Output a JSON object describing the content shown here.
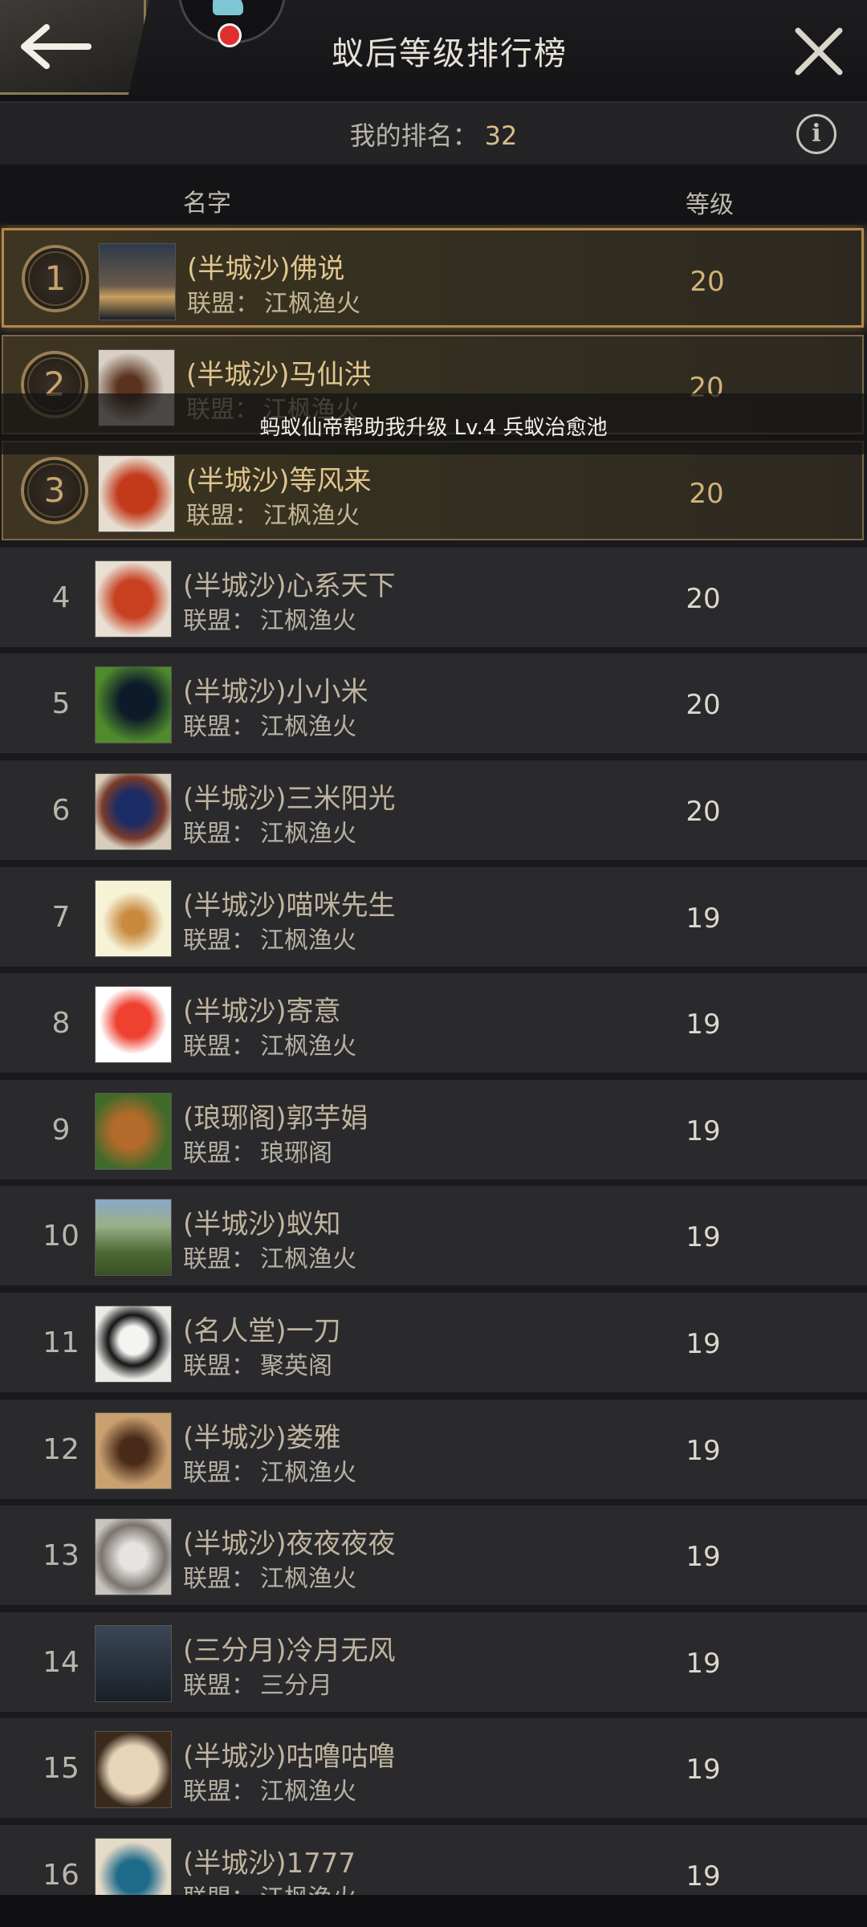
{
  "header": {
    "title": "蚁后等级排行榜"
  },
  "my_rank": {
    "label": "我的排名：",
    "value": "32"
  },
  "columns": {
    "name": "名字",
    "level": "等级"
  },
  "alliance_label": "联盟：",
  "toast": "蚂蚁仙帝帮助我升级 Lv.4 兵蚁治愈池",
  "colors": {
    "accent_gold": "#d3b27a",
    "background": "#1a1a1c",
    "row_background": "#2a292b",
    "toast_text": "#f3f1ec"
  },
  "icons": {
    "back": "arrow-left-icon",
    "close": "close-icon",
    "info": "info-icon",
    "medal": "rank-medal-icon"
  },
  "rows": [
    {
      "rank": "1",
      "name": "(半城沙)佛说",
      "alliance": "江枫渔火",
      "level": "20"
    },
    {
      "rank": "2",
      "name": "(半城沙)马仙洪",
      "alliance": "江枫渔火",
      "level": "20"
    },
    {
      "rank": "3",
      "name": "(半城沙)等风来",
      "alliance": "江枫渔火",
      "level": "20"
    },
    {
      "rank": "4",
      "name": "(半城沙)心系天下",
      "alliance": "江枫渔火",
      "level": "20"
    },
    {
      "rank": "5",
      "name": "(半城沙)小小米",
      "alliance": "江枫渔火",
      "level": "20"
    },
    {
      "rank": "6",
      "name": "(半城沙)三米阳光",
      "alliance": "江枫渔火",
      "level": "20"
    },
    {
      "rank": "7",
      "name": "(半城沙)喵咪先生",
      "alliance": "江枫渔火",
      "level": "19"
    },
    {
      "rank": "8",
      "name": "(半城沙)寄意",
      "alliance": "江枫渔火",
      "level": "19"
    },
    {
      "rank": "9",
      "name": "(琅琊阁)郭芋娟",
      "alliance": "琅琊阁",
      "level": "19"
    },
    {
      "rank": "10",
      "name": "(半城沙)蚁知",
      "alliance": "江枫渔火",
      "level": "19"
    },
    {
      "rank": "11",
      "name": "(名人堂)一刀",
      "alliance": "聚英阁",
      "level": "19"
    },
    {
      "rank": "12",
      "name": "(半城沙)娄雅",
      "alliance": "江枫渔火",
      "level": "19"
    },
    {
      "rank": "13",
      "name": "(半城沙)夜夜夜夜",
      "alliance": "江枫渔火",
      "level": "19"
    },
    {
      "rank": "14",
      "name": "(三分月)冷月无风",
      "alliance": "三分月",
      "level": "19"
    },
    {
      "rank": "15",
      "name": "(半城沙)咕噜咕噜",
      "alliance": "江枫渔火",
      "level": "19"
    },
    {
      "rank": "16",
      "name": "(半城沙)1777",
      "alliance": "江枫渔火",
      "level": "19"
    }
  ]
}
